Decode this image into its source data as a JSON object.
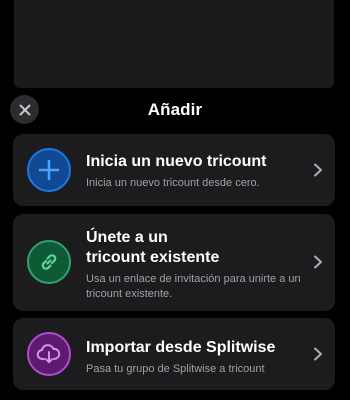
{
  "sheet": {
    "title": "Añadir",
    "close_icon": "close-icon"
  },
  "options": [
    {
      "title": "Inicia un nuevo tricount",
      "subtitle": "Inicia un nuevo tricount desde cero.",
      "icon": "plus-icon",
      "accent": "#1d79e0"
    },
    {
      "title": "Únete a un tricount existente",
      "subtitle": "Usa un enlace de invitación para unirte a un tricount existente.",
      "icon": "link-icon",
      "accent": "#2fa36a"
    },
    {
      "title": "Importar desde Splitwise",
      "subtitle": "Pasa tu grupo de Splitwise a tricount",
      "icon": "cloud-download-icon",
      "accent": "#b04bd0"
    }
  ]
}
